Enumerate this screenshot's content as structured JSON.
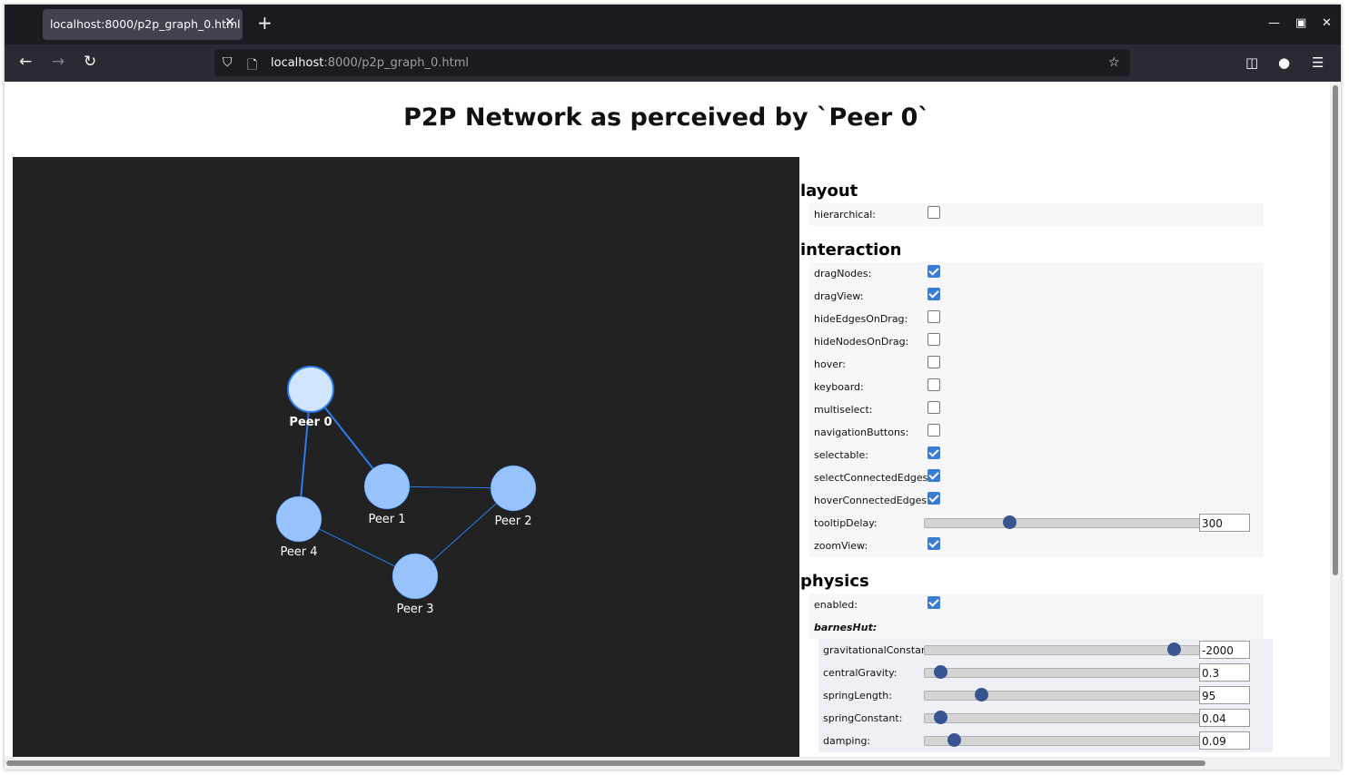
{
  "browser": {
    "tab_title": "localhost:8000/p2p_graph_0.html",
    "url_host": "localhost",
    "url_rest": ":8000/p2p_graph_0.html",
    "colors": {
      "tabstrip": "#1c1b22",
      "navbar": "#2b2a33",
      "tab": "#42414d"
    }
  },
  "page": {
    "title": "P2P Network as perceived by `Peer 0`"
  },
  "graph": {
    "background": "#222222",
    "node_color": "#97c2fc",
    "selected_node_color": "#d2e5ff",
    "edge_color": "#2b7ce9",
    "nodes": [
      {
        "id": "peer0",
        "label": "Peer 0",
        "selected": true
      },
      {
        "id": "peer1",
        "label": "Peer 1"
      },
      {
        "id": "peer2",
        "label": "Peer 2"
      },
      {
        "id": "peer3",
        "label": "Peer 3"
      },
      {
        "id": "peer4",
        "label": "Peer 4"
      }
    ],
    "edges": [
      {
        "from": "peer0",
        "to": "peer1"
      },
      {
        "from": "peer0",
        "to": "peer4"
      },
      {
        "from": "peer1",
        "to": "peer2"
      },
      {
        "from": "peer2",
        "to": "peer3"
      },
      {
        "from": "peer3",
        "to": "peer4"
      }
    ]
  },
  "config": {
    "layout": {
      "header": "layout",
      "hierarchical": {
        "label": "hierarchical:",
        "checked": false
      }
    },
    "interaction": {
      "header": "interaction",
      "options": [
        {
          "label": "dragNodes:",
          "checked": true
        },
        {
          "label": "dragView:",
          "checked": true
        },
        {
          "label": "hideEdgesOnDrag:",
          "checked": false
        },
        {
          "label": "hideNodesOnDrag:",
          "checked": false
        },
        {
          "label": "hover:",
          "checked": false
        },
        {
          "label": "keyboard:",
          "checked": false
        },
        {
          "label": "multiselect:",
          "checked": false
        },
        {
          "label": "navigationButtons:",
          "checked": false
        },
        {
          "label": "selectable:",
          "checked": true
        },
        {
          "label": "selectConnectedEdges:",
          "checked": true
        },
        {
          "label": "hoverConnectedEdges:",
          "checked": true
        }
      ],
      "tooltipDelay": {
        "label": "tooltipDelay:",
        "value": "300",
        "fraction": 0.31
      },
      "zoomView": {
        "label": "zoomView:",
        "checked": true
      }
    },
    "physics": {
      "header": "physics",
      "enabled": {
        "label": "enabled:",
        "checked": true
      },
      "barnesHut": "barnesHut:",
      "sliders": [
        {
          "label": "gravitationalConstant:",
          "value": "-2000",
          "fraction": 0.91
        },
        {
          "label": "centralGravity:",
          "value": "0.3",
          "fraction": 0.06
        },
        {
          "label": "springLength:",
          "value": "95",
          "fraction": 0.21
        },
        {
          "label": "springConstant:",
          "value": "0.04",
          "fraction": 0.06
        },
        {
          "label": "damping:",
          "value": "0.09",
          "fraction": 0.11
        }
      ]
    }
  }
}
